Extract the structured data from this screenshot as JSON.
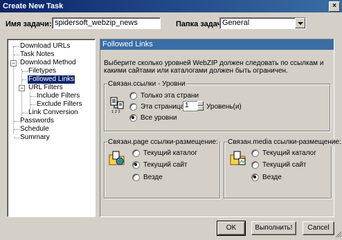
{
  "window": {
    "title": "Create New Task",
    "close_glyph": "×"
  },
  "task": {
    "name_label": "Имя задачи:",
    "name_value": "spidersoft_webzip_news",
    "folder_label": "Папка задач:",
    "folder_value": "General"
  },
  "tree": {
    "items": [
      {
        "label": "Download URLs"
      },
      {
        "label": "Task Notes"
      },
      {
        "label": "Download Method",
        "expander": "−"
      },
      {
        "label": "Filetypes"
      },
      {
        "label": "Followed Links",
        "selected": true
      },
      {
        "label": "URL Filters",
        "expander": "−"
      },
      {
        "label": "Include Filters"
      },
      {
        "label": "Exclude Filters"
      },
      {
        "label": "Link Conversion"
      },
      {
        "label": "Passwords"
      },
      {
        "label": "Schedule"
      },
      {
        "label": "Summary"
      }
    ]
  },
  "panel": {
    "header": "Followed Links",
    "description": "Выберите сколько уровней WebZIP должен следовать по ссылкам и какими сайтами или каталогами должен быть ограничен.",
    "levels": {
      "title": "Связан.ссылки - Уровни",
      "options": [
        "Только эта страни",
        "Эта страница",
        "Все уровни"
      ],
      "selected_index": 2,
      "spin_value": "1",
      "spin_suffix": "Уровень(и)"
    },
    "page_links": {
      "title": "Связан.page ссылки-размещение:",
      "options": [
        "Текущий каталог",
        "Текущий сайт",
        "Везде"
      ],
      "selected_index": 1
    },
    "media_links": {
      "title": "Связан.media ссылки-размещение:",
      "options": [
        "Текущий каталог",
        "Текущий сайт",
        "Везде"
      ],
      "selected_index": 2
    }
  },
  "buttons": {
    "ok": "OK",
    "run": "Выполнить!",
    "cancel": "Cancel"
  },
  "icons": {
    "levels": "pages-levels-icon",
    "page": "folder-page-icon",
    "media": "folder-media-icon"
  }
}
